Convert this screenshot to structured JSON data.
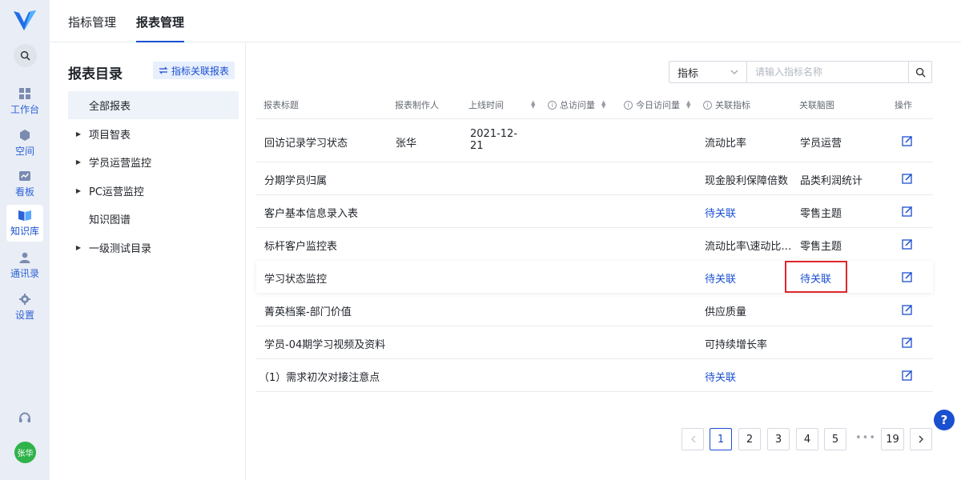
{
  "nav": {
    "items": [
      {
        "label": "工作台",
        "icon": "grid-icon"
      },
      {
        "label": "空间",
        "icon": "cube-icon"
      },
      {
        "label": "看板",
        "icon": "chart-icon"
      },
      {
        "label": "知识库",
        "icon": "book-icon"
      },
      {
        "label": "通讯录",
        "icon": "user-icon"
      },
      {
        "label": "设置",
        "icon": "gear-icon"
      }
    ],
    "avatar": "张华"
  },
  "tabs": [
    "指标管理",
    "报表管理"
  ],
  "sidebar": {
    "title": "报表目录",
    "link_button": "指标关联报表",
    "tree": [
      {
        "label": "全部报表",
        "expandable": false
      },
      {
        "label": "项目智表",
        "expandable": true
      },
      {
        "label": "学员运营监控",
        "expandable": true
      },
      {
        "label": "PC运营监控",
        "expandable": true
      },
      {
        "label": "知识图谱",
        "expandable": false
      },
      {
        "label": "一级测试目录",
        "expandable": true
      }
    ]
  },
  "filter": {
    "select_value": "指标",
    "placeholder": "请输入指标名称"
  },
  "table": {
    "headers": [
      "报表标题",
      "报表制作人",
      "上线时间",
      "总访问量",
      "今日访问量",
      "关联指标",
      "关联脑图",
      "操作"
    ],
    "rows": [
      {
        "title": "回访记录学习状态",
        "author": "张华",
        "date": "2021-12-21",
        "metric": "流动比率",
        "mindmap": "学员运营"
      },
      {
        "title": "分期学员归属",
        "author": "",
        "date": "",
        "metric": "现金股利保障倍数",
        "mindmap": "品类利润统计"
      },
      {
        "title": "客户基本信息录入表",
        "author": "",
        "date": "",
        "metric": "待关联",
        "mindmap": "零售主题"
      },
      {
        "title": "标杆客户监控表",
        "author": "",
        "date": "",
        "metric": "流动比率\\速动比…",
        "mindmap": "零售主题"
      },
      {
        "title": "学习状态监控",
        "author": "",
        "date": "",
        "metric": "待关联",
        "mindmap": "待关联"
      },
      {
        "title": "菁英档案-部门价值",
        "author": "",
        "date": "",
        "metric": "供应质量",
        "mindmap": ""
      },
      {
        "title": "学员-04期学习视频及资料",
        "author": "",
        "date": "",
        "metric": "可持续增长率",
        "mindmap": ""
      },
      {
        "title": "（1）需求初次对接注意点",
        "author": "",
        "date": "",
        "metric": "待关联",
        "mindmap": ""
      }
    ]
  },
  "pagination": {
    "pages": [
      "1",
      "2",
      "3",
      "4",
      "5"
    ],
    "last": "19",
    "current": "1",
    "ellipsis": "•••"
  },
  "colors": {
    "accent": "#1a4fd0",
    "highlight_box": "#e0262b",
    "nav_bg": "#e9edf5"
  }
}
